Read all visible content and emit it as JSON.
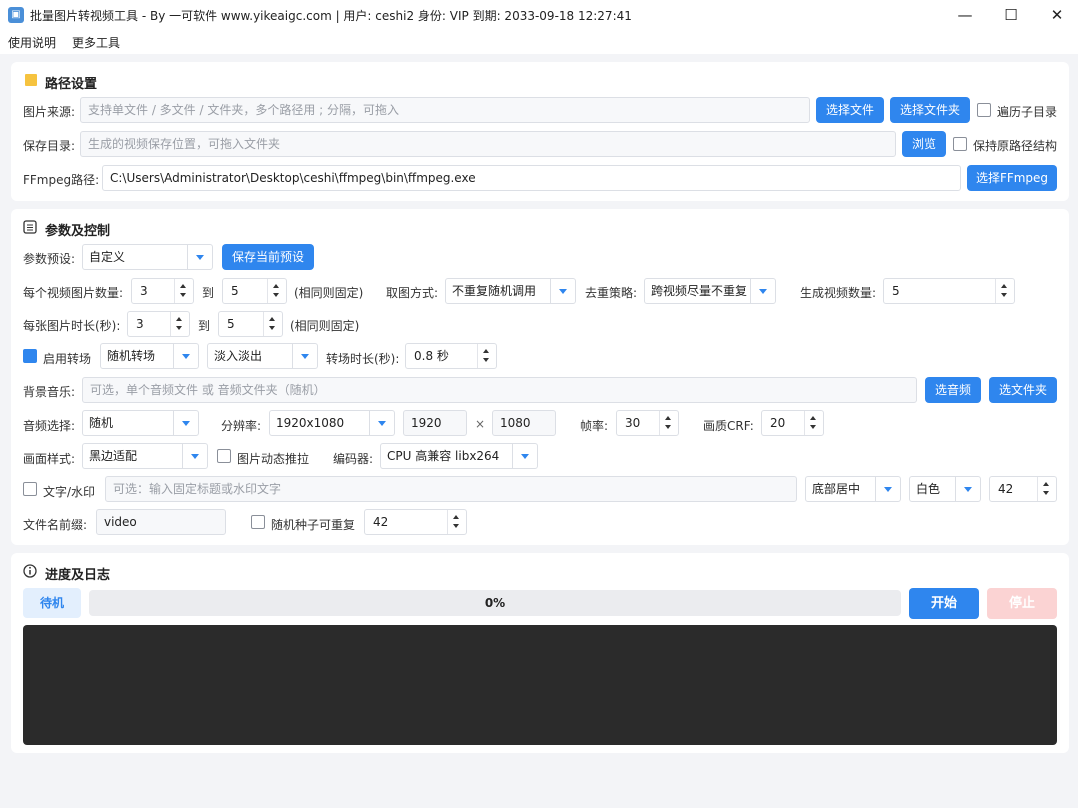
{
  "window": {
    "title": "批量图片转视频工具 - By 一可软件 www.yikeaigc.com  |  用户: ceshi2  身份: VIP  到期: 2033-09-18 12:27:41",
    "minimize": "—",
    "maximize": "☐",
    "close": "✕"
  },
  "menu": [
    "使用说明",
    "更多工具"
  ],
  "path": {
    "title": "路径设置",
    "source_label": "图片来源:",
    "source_placeholder": "支持单文件 / 多文件 / 文件夹，多个路径用 ; 分隔，可拖入",
    "select_file": "选择文件",
    "select_folder": "选择文件夹",
    "traverse_label": "遍历子目录",
    "save_label": "保存目录:",
    "save_placeholder": "生成的视频保存位置，可拖入文件夹",
    "browse": "浏览",
    "keep_structure_label": "保持原路径结构",
    "ffmpeg_label": "FFmpeg路径:",
    "ffmpeg_value": "C:\\Users\\Administrator\\Desktop\\ceshi\\ffmpeg\\bin\\ffmpeg.exe",
    "select_ffmpeg": "选择FFmpeg"
  },
  "params": {
    "title": "参数及控制",
    "preset_label": "参数预设:",
    "preset_value": "自定义",
    "save_preset": "保存当前预设",
    "img_count_label": "每个视频图片数量:",
    "img_count_min": "3",
    "to": "到",
    "img_count_max": "5",
    "same_fixed": "(相同则固定)",
    "pick_label": "取图方式:",
    "pick_value": "不重复随机调用",
    "dedup_label": "去重策略:",
    "dedup_value": "跨视频尽量不重复",
    "video_count_label": "生成视频数量:",
    "video_count_value": "5",
    "duration_label": "每张图片时长(秒):",
    "duration_min": "3",
    "duration_max": "5",
    "transition_label": "启用转场",
    "transition_mode": "随机转场",
    "transition_type": "淡入淡出",
    "transition_dur_label": "转场时长(秒):",
    "transition_dur_value": "0.8 秒",
    "bgm_label": "背景音乐:",
    "bgm_placeholder": "可选，单个音频文件 或 音频文件夹（随机）",
    "select_audio": "选音频",
    "select_audio_folder": "选文件夹",
    "audio_select_label": "音频选择:",
    "audio_select_value": "随机",
    "resolution_label": "分辨率:",
    "resolution_value": "1920x1080",
    "width": "1920",
    "times": "×",
    "height": "1080",
    "fps_label": "帧率:",
    "fps_value": "30",
    "crf_label": "画质CRF:",
    "crf_value": "20",
    "style_label": "画面样式:",
    "style_value": "黑边适配",
    "kenburns_label": "图片动态推拉",
    "encoder_label": "编码器:",
    "encoder_value": "CPU 高兼容 libx264",
    "watermark_label": "文字/水印",
    "watermark_placeholder": "可选：输入固定标题或水印文字",
    "wm_position": "底部居中",
    "wm_color": "白色",
    "wm_size": "42",
    "prefix_label": "文件名前缀:",
    "prefix_value": "video",
    "seed_label": "随机种子可重复",
    "seed_value": "42"
  },
  "progress": {
    "title": "进度及日志",
    "status": "待机",
    "percent_text": "0%",
    "percent": 0,
    "start": "开始",
    "stop": "停止"
  },
  "colors": {
    "accent": "#2f86ee",
    "stop_disabled": "#fbd3d3",
    "log_bg": "#2b2b2b"
  }
}
